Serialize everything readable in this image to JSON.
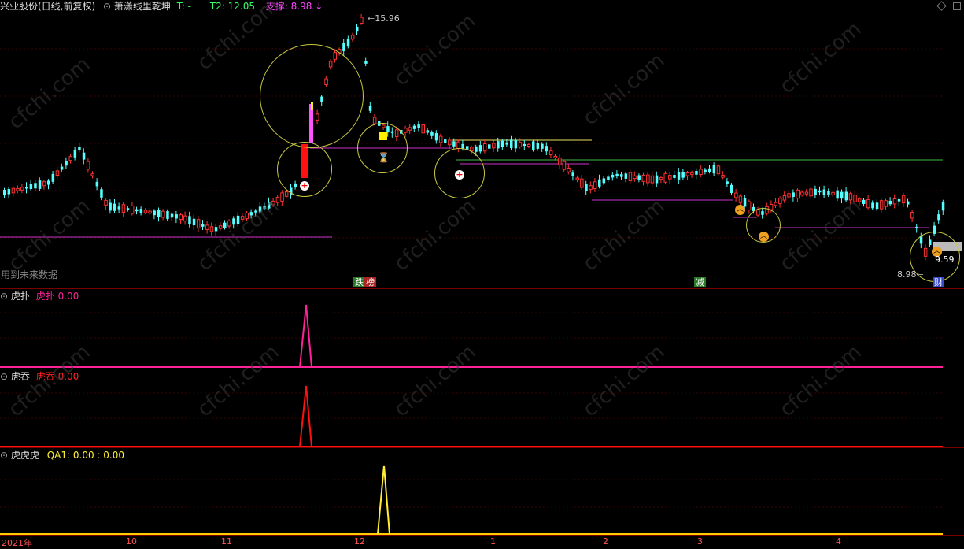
{
  "header": {
    "stock": "兴业股份(日线,前复权)",
    "indicator": "萧潇线里乾坤",
    "t_label": "T: -",
    "t2_label": "T2: 12.05",
    "support_label": "支撑: 8.98",
    "arrow": "↓"
  },
  "price_labels": {
    "high": "15.96",
    "low": "8.98",
    "last": "9.59"
  },
  "note": "用到未来数据",
  "markers": {
    "m1": "跌",
    "m2": "榜",
    "m3": "减",
    "m4": "财"
  },
  "panels": {
    "p1": {
      "title": "虎扑",
      "series": "虎扑",
      "value": "0.00"
    },
    "p2": {
      "title": "虎吞",
      "series": "虎吞",
      "value": "0.00"
    },
    "p3": {
      "title": "虎虎虎",
      "series": "QA1",
      "value": "0.00 : 0.00"
    }
  },
  "xaxis": [
    "2021年",
    "10",
    "11",
    "12",
    "1",
    "2",
    "3",
    "4"
  ],
  "colors": {
    "up": "#ff3333",
    "down": "#54ffff",
    "purple": "#cc33cc",
    "yellow": "#e8e060",
    "green": "#44bb44"
  },
  "watermark": "cfchi.com"
}
